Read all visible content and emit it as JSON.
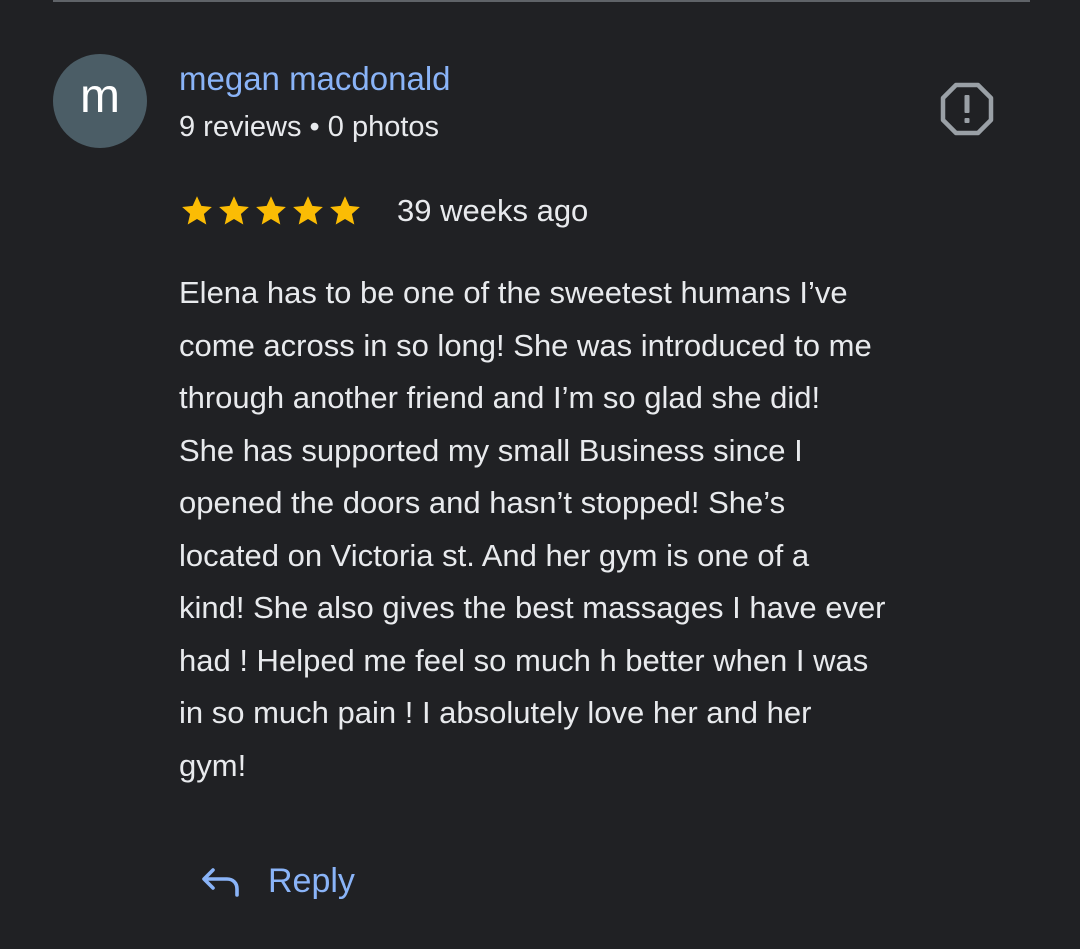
{
  "review": {
    "author": {
      "avatar_letter": "m",
      "name": "megan macdonald",
      "meta": "9 reviews • 0 photos"
    },
    "rating": 5,
    "rating_max": 5,
    "time_ago": "39 weeks ago",
    "text_lines": [
      "Elena has to be one of the sweetest humans I’ve",
      "come across in so long! She was introduced to me",
      "through another friend and I’m so glad she did!",
      "She has supported my small Business since I",
      "opened the doors and hasn’t stopped! She’s",
      "located on Victoria st. And her gym is one of a",
      "kind! She also gives the best massages I have ever",
      "had ! Helped me feel so much h better when I was",
      "in so much pain ! I absolutely love her and her",
      "gym!"
    ],
    "reply_label": "Reply"
  },
  "icons": {
    "report": "report-flag-icon",
    "star": "star-icon",
    "reply": "reply-arrow-icon"
  },
  "colors": {
    "background": "#202124",
    "link": "#8ab4f8",
    "text": "#e8eaed",
    "star": "#fbbc04",
    "avatar": "#4b5d66",
    "icon": "#9aa0a6"
  }
}
